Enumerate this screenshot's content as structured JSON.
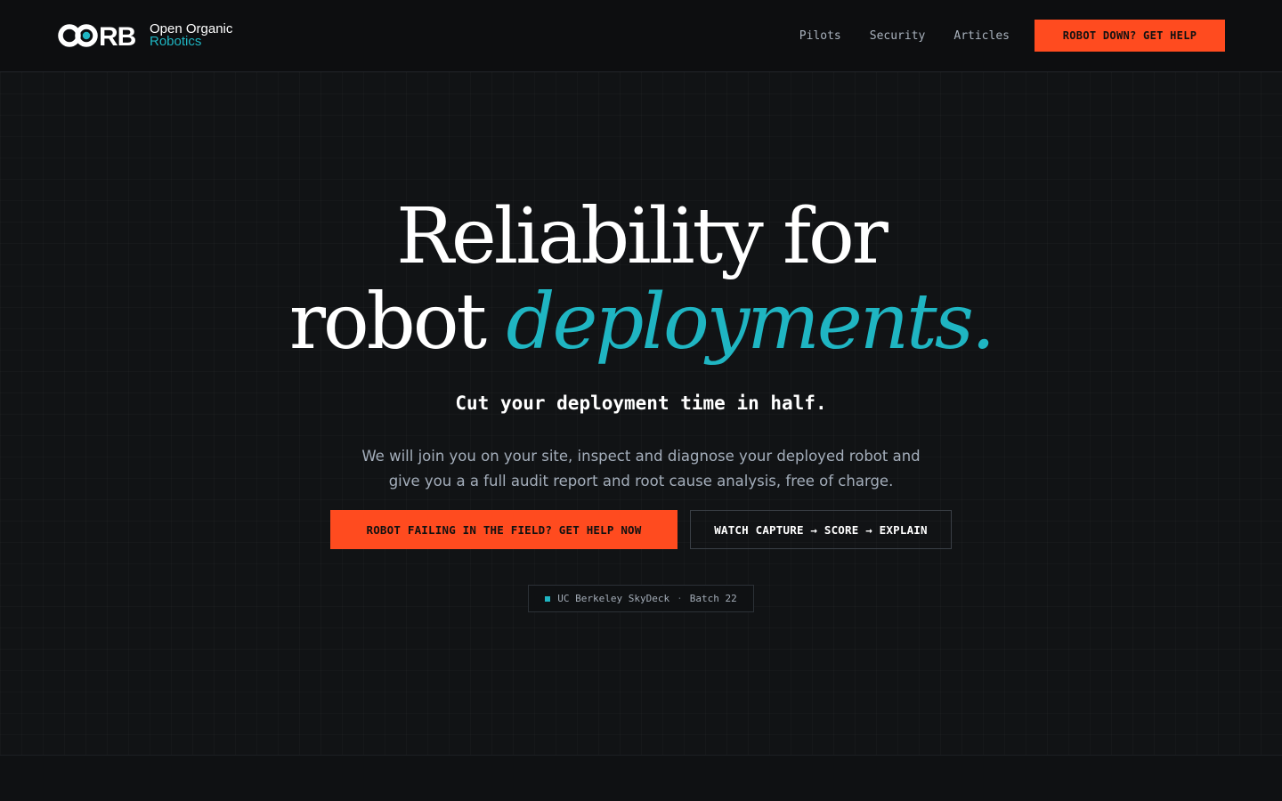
{
  "brand": {
    "mark": "OORB",
    "line1": "Open Organic",
    "line2": "Robotics",
    "accent_color": "#1fb5c2",
    "cta_color": "#ff4b1f"
  },
  "nav": {
    "links": [
      "Pilots",
      "Security",
      "Articles"
    ],
    "cta": "ROBOT DOWN? GET HELP"
  },
  "hero": {
    "title_line1": "Reliability for",
    "title_line2_plain": "robot ",
    "title_line2_accent": "deployments.",
    "subhead": "Cut your deployment time in half.",
    "body": "We will join you on your site, inspect and diagnose your deployed robot and give you a a full audit report and root cause analysis, free of charge.",
    "primary_button": "ROBOT FAILING IN THE FIELD? GET HELP NOW",
    "secondary_button": "WATCH CAPTURE → SCORE → EXPLAIN",
    "badge": {
      "org": "UC Berkeley SkyDeck",
      "separator": "·",
      "batch": "Batch 22"
    }
  }
}
